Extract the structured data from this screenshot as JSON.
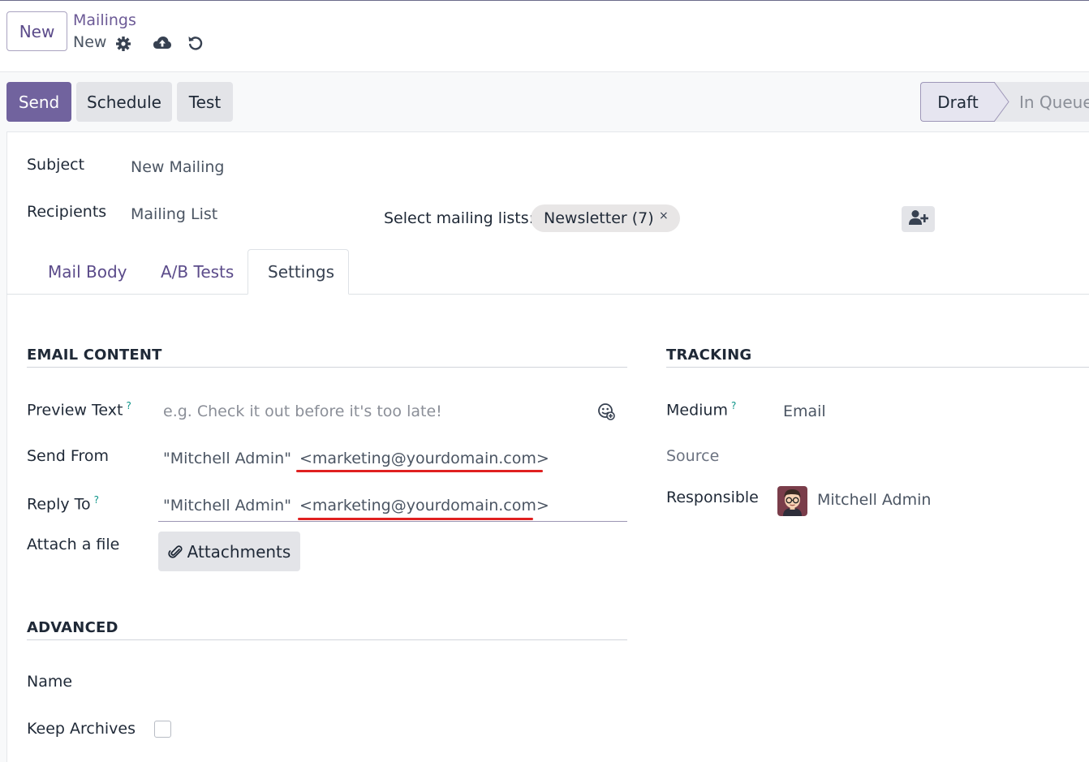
{
  "control_panel": {
    "new_label": "New",
    "breadcrumb_parent": "Mailings",
    "breadcrumb_current": "New"
  },
  "actions": {
    "send": "Send",
    "schedule": "Schedule",
    "test": "Test"
  },
  "statusbar": {
    "draft": "Draft",
    "in_queue": "In Queue"
  },
  "header_fields": {
    "subject_label": "Subject",
    "subject_value": "New Mailing",
    "recipients_label": "Recipients",
    "recipients_value": "Mailing List",
    "select_lists_label": "Select mailing lists:",
    "mailing_list_tag": "Newsletter (7)",
    "tag_remove": "×"
  },
  "tabs": [
    "Mail Body",
    "A/B Tests",
    "Settings"
  ],
  "email_content": {
    "section_title": "EMAIL CONTENT",
    "preview_label": "Preview Text",
    "preview_placeholder": "e.g. Check it out before it's too late!",
    "help_mark": "?",
    "send_from_label": "Send From",
    "send_from_name": "\"Mitchell Admin\"",
    "send_from_email": "<marketing@yourdomain.com>",
    "reply_to_label": "Reply To",
    "reply_to_name": "\"Mitchell Admin\"",
    "reply_to_email": "<marketing@yourdomain.com>",
    "attach_label": "Attach a file",
    "attach_button": "Attachments"
  },
  "tracking": {
    "section_title": "TRACKING",
    "medium_label": "Medium",
    "medium_value": "Email",
    "source_label": "Source",
    "responsible_label": "Responsible",
    "responsible_value": "Mitchell Admin"
  },
  "advanced": {
    "section_title": "ADVANCED",
    "name_label": "Name",
    "keep_archives_label": "Keep Archives",
    "keep_archives_checked": false
  },
  "colors": {
    "primary": "#71639e",
    "link": "#6c5a96",
    "help": "#0d9488",
    "annotation_underline": "#e02020"
  }
}
